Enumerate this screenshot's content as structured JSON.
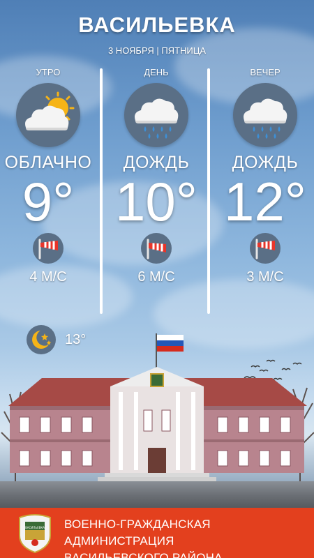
{
  "header": {
    "city": "ВАСИЛЬЕВКА",
    "date": "3 НОЯБРЯ | ПЯТНИЦА"
  },
  "periods": [
    {
      "label": "УТРО",
      "condition": "ОБЛАЧНО",
      "temp": "9°",
      "wind": "4 М/С",
      "icon": "partly-cloudy-icon"
    },
    {
      "label": "ДЕНЬ",
      "condition": "ДОЖДЬ",
      "temp": "10°",
      "wind": "6 М/С",
      "icon": "rain-cloud-icon"
    },
    {
      "label": "ВЕЧЕР",
      "condition": "ДОЖДЬ",
      "temp": "12°",
      "wind": "3 М/С",
      "icon": "rain-cloud-icon"
    }
  ],
  "night": {
    "temp": "13°",
    "icon": "moon-stars-icon"
  },
  "footer": {
    "line1": "ВОЕННО-ГРАЖДАНСКАЯ АДМИНИСТРАЦИЯ",
    "line2": "ВАСИЛЬЕВСКОГО РАЙОНА",
    "emblem_text": "ВАСИЛЬЕВКА"
  },
  "colors": {
    "footer_bg": "#e3401e",
    "icon_circle": "#5a6f86",
    "sun": "#f6b417",
    "rain": "#3d8fd6",
    "windsock_red": "#e8352a",
    "building_wall": "#b8848e",
    "roof": "#a64a46"
  }
}
